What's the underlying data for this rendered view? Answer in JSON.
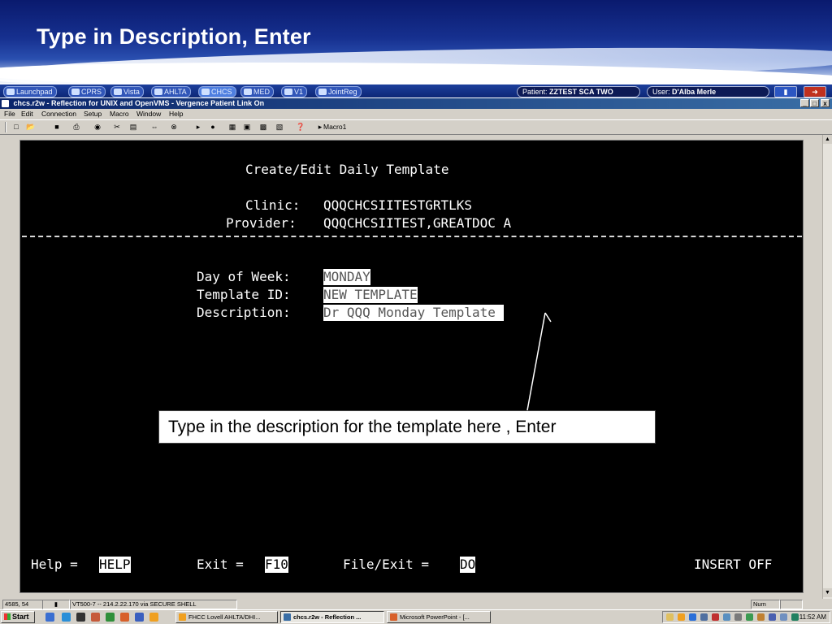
{
  "slide": {
    "title": "Type in Description, Enter"
  },
  "launch_bar": {
    "buttons": [
      "Launchpad",
      "CPRS",
      "Vista",
      "AHLTA",
      "CHCS",
      "MED",
      "V1",
      "JointReg"
    ],
    "patient_label": "Patient:",
    "patient_value": "ZZTEST SCA TWO",
    "user_label": "User:",
    "user_value": "D'Alba Merle"
  },
  "window": {
    "title": "chcs.r2w - Reflection for UNIX and OpenVMS - Vergence Patient Link On",
    "controls": [
      "_",
      "□",
      "x"
    ]
  },
  "menu": [
    "File",
    "Edit",
    "Connection",
    "Setup",
    "Macro",
    "Window",
    "Help"
  ],
  "toolbar": {
    "macro_label": "Macro1"
  },
  "terminal": {
    "screen_title": "Create/Edit Daily Template",
    "clinic_label": "Clinic:",
    "clinic_value": "QQQCHCSIITESTGRTLKS",
    "provider_label": "Provider:",
    "provider_value": "QQQCHCSIITEST,GREATDOC A",
    "day_label": "Day of Week:",
    "day_value": "MONDAY",
    "template_label": "Template ID:",
    "template_value": "NEW TEMPLATE",
    "description_label": "Description:",
    "description_value": "Dr QQQ Monday Template ",
    "footer": {
      "help_label": "Help =",
      "help_key": "HELP",
      "exit_label": "Exit =",
      "exit_key": "F10",
      "fileexit_label": "File/Exit =",
      "fileexit_key": "DO",
      "insert_status": "INSERT OFF"
    }
  },
  "callout": {
    "text": "Type in the description for the template here , Enter"
  },
  "status_bar": {
    "position": "4585, 54",
    "connection": "VT500-7 -- 214.2.22.170 via SECURE SHELL",
    "num": "Num"
  },
  "taskbar": {
    "start_label": "Start",
    "tasks": [
      "FHCC Lovell AHLTA/DHI...",
      "chcs.r2w - Reflection ...",
      "Microsoft PowerPoint - [..."
    ],
    "clock": "11:52 AM"
  }
}
